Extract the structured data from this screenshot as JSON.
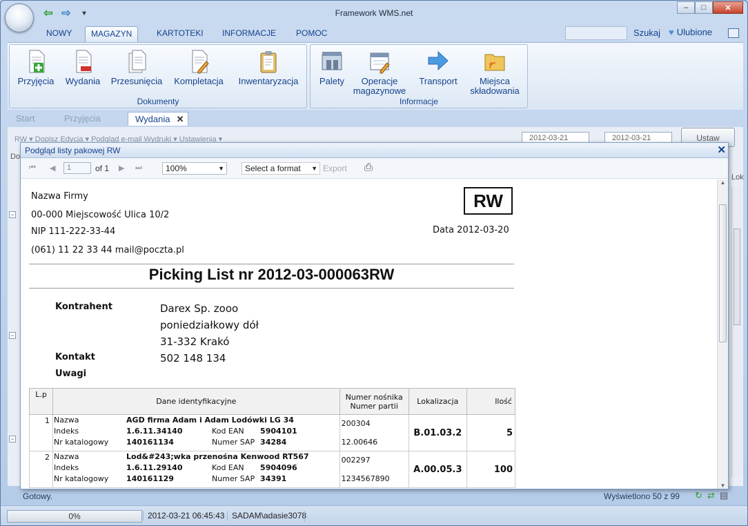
{
  "window": {
    "title": "Framework WMS.net"
  },
  "ribbon": {
    "tabs": [
      "NOWY",
      "MAGAZYN",
      "KARTOTEKI",
      "INFORMACJE",
      "POMOC"
    ],
    "selected_tab": "MAGAZYN",
    "search_label": "Szukaj",
    "favorites_label": "Ulubione",
    "groups": [
      {
        "label": "Dokumenty",
        "buttons": [
          "Przyjęcia",
          "Wydania",
          "Przesunięcia",
          "Kompletacja",
          "Inwentaryzacja"
        ]
      },
      {
        "label": "Informacje",
        "buttons": [
          "Palety",
          "Operacje magazynowe",
          "Transport",
          "Miejsca składowania"
        ]
      }
    ]
  },
  "doc_tabs": [
    "Start",
    "Przyjęcia",
    "Wydania"
  ],
  "doc_tab_selected": "Wydania",
  "background": {
    "toolbar": "RW ▾   Dopisz   Edycja ▾   Podgląd   e-mail   Wydruki ▾   Ustawienia ▾",
    "date_from": "2012-03-21",
    "date_to": "2012-03-21",
    "ustaw_button": "Ustaw",
    "col_left": "Do",
    "col_right": "Lok"
  },
  "dialog": {
    "title": "Podgląd listy pakowej RW",
    "page_value": "1",
    "page_of": "of 1",
    "zoom": "100%",
    "format_placeholder": "Select a format",
    "export_label": "Export"
  },
  "report": {
    "company_name": "Nazwa Firmy",
    "address": "00-000 Miejscowość Ulica 10/2",
    "nip": "NIP 111-222-33-44",
    "contact_line": "(061) 11 22 33 44 mail@poczta.pl",
    "doc_type": "RW",
    "date": "Data 2012-03-20",
    "title": "Picking List nr 2012-03-000063RW",
    "contractor_label": "Kontrahent",
    "contractor_lines": [
      "Darex Sp. zooo",
      "poniedziałkowy dół",
      "31-332 Krakó"
    ],
    "contact_label": "Kontakt",
    "contact_value": "502 148 134",
    "notes_label": "Uwagi",
    "table_headers": {
      "lp": "L.p",
      "dane": "Dane identyfikacyjne",
      "nosnik": "Numer nośnika",
      "partia": "Numer partii",
      "lok": "Lokalizacja",
      "ilosc": "Ilość"
    },
    "field_labels": {
      "nazwa": "Nazwa",
      "indeks": "Indeks",
      "katalog": "Nr katalogowy",
      "ean": "Kod EAN",
      "sap": "Numer SAP"
    },
    "items": [
      {
        "lp": "1",
        "nazwa": "AGD firma Adam i Adam Lodówki LG 34",
        "indeks": "1.6.11.34140",
        "ean": "5904101",
        "katalog": "140161134",
        "sap": "34284",
        "nosnik": "200304",
        "partia": "12.00646",
        "lok": "B.01.03.2",
        "ilosc": "5"
      },
      {
        "lp": "2",
        "nazwa": "Lod&#243;wka przenośna Kenwood RT567",
        "indeks": "1.6.11.29140",
        "ean": "5904096",
        "katalog": "140161129",
        "sap": "34391",
        "nosnik": "002297",
        "partia": "1234567890",
        "lok": "A.00.05.3",
        "ilosc": "100"
      }
    ]
  },
  "status": {
    "ready": "Gotowy.",
    "shown": "Wyświetlono 50 z 99",
    "progress": "0%",
    "progress_value": 0,
    "datetime": "2012-03-21 06:45:43",
    "user": "SADAM\\adasie3078"
  }
}
